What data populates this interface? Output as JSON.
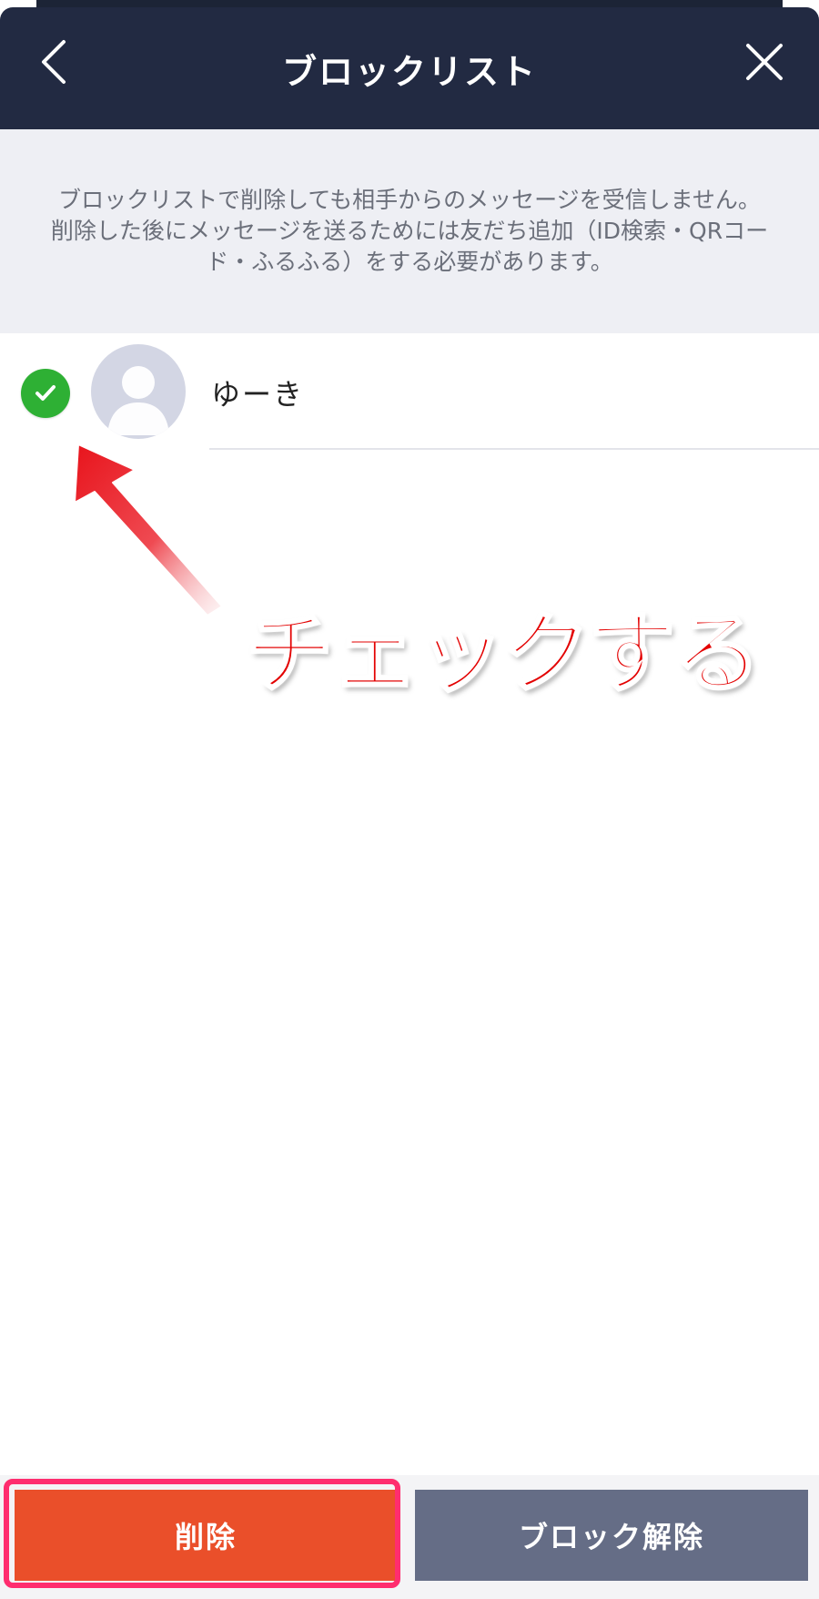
{
  "header": {
    "title": "ブロックリスト",
    "back_icon": "chevron-left-icon",
    "close_icon": "close-icon"
  },
  "notice": {
    "text": "ブロックリストで削除しても相手からのメッセージを受信しません。\n削除した後にメッセージを送るためには友だち追加（ID検索・QRコード・ふるふる）をする必要があります。"
  },
  "blocked_list": [
    {
      "name": "ゆーき",
      "selected": true,
      "avatar_icon": "default-avatar-icon"
    }
  ],
  "annotation": {
    "text": "チェックする",
    "color": "#e30000"
  },
  "actions": {
    "delete_label": "削除",
    "unblock_label": "ブロック解除",
    "delete_color": "#ea4f2a",
    "unblock_color": "#656d86",
    "highlight_color": "#ff2d6f"
  },
  "colors": {
    "header_bg": "#222a42",
    "notice_bg": "#eeeff4",
    "check_green": "#2eb034"
  }
}
